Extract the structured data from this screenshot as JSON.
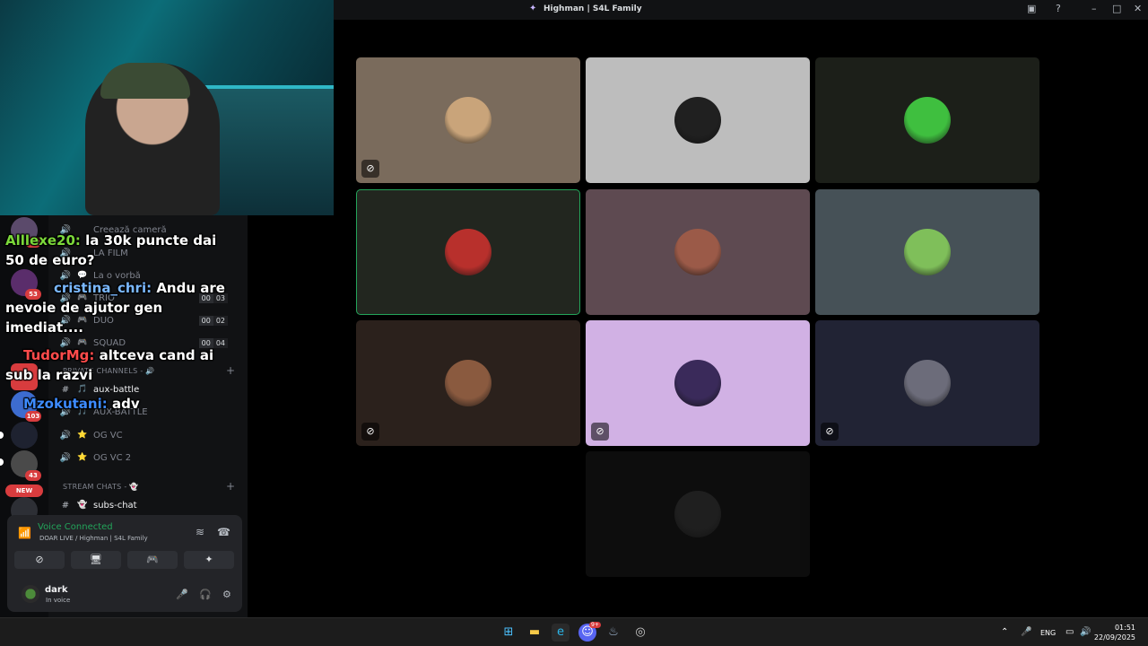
{
  "window": {
    "title": "Highman | S4L Family"
  },
  "server_rail": {
    "badges": [
      "143",
      "53",
      "103",
      "43",
      "10"
    ],
    "new_label": "NEW"
  },
  "channels": [
    {
      "name": "Creează cameră",
      "emoji": ""
    },
    {
      "name": "LA FILM",
      "emoji": ""
    },
    {
      "name": "La o vorbă",
      "emoji": "💬"
    },
    {
      "name": "TRIO",
      "emoji": "🎮",
      "count_a": "00",
      "count_b": "03"
    },
    {
      "name": "DUO",
      "emoji": "🎮",
      "count_a": "00",
      "count_b": "02"
    },
    {
      "name": "SQUAD",
      "emoji": "🎮",
      "count_a": "00",
      "count_b": "04"
    },
    {
      "name": "aux-battle",
      "emoji": "🎵"
    },
    {
      "name": "AUX-BATTLE",
      "emoji": "🎵"
    },
    {
      "name": "OG VC",
      "emoji": "⭐"
    },
    {
      "name": "OG VC 2",
      "emoji": "⭐"
    },
    {
      "name": "subs-chat",
      "emoji": "👻"
    }
  ],
  "categories": {
    "private": "PRIVATE CHANNELS - 🔊",
    "stream": "STREAM CHATS - 👻"
  },
  "chat_overlay": [
    {
      "user": "Alllexe20:",
      "text": " la 30k puncte dai 50 de euro?",
      "color": "#7bd83a"
    },
    {
      "user": "cristina_chri:",
      "text": " Andu are nevoie de ajutor gen imediat....",
      "color": "#7ab8ff"
    },
    {
      "user": "TudorMg:",
      "text": " altceva cand ai sub la razvi",
      "color": "#ff4b4b"
    },
    {
      "user": "Mzokutani:",
      "text": " adv",
      "color": "#3d8bff"
    }
  ],
  "voice": {
    "status": "Voice Connected",
    "channel": "DOAR LIVE / Highman | S4L Family"
  },
  "user": {
    "name": "dark",
    "status": "In voice"
  },
  "tiles": [
    {
      "bg": "#7a6b5c",
      "avatar": "#c9a47a",
      "muted": true,
      "mute_icon": "🎧"
    },
    {
      "bg": "#bdbdbd",
      "avatar": "#202020",
      "muted": false,
      "mute_icon": ""
    },
    {
      "bg": "#1c1f19",
      "avatar": "#3fbf3f",
      "muted": false,
      "mute_icon": ""
    },
    {
      "bg": "#22261f",
      "avatar": "#b8302c",
      "muted": false,
      "mute_icon": "",
      "speaking": true
    },
    {
      "bg": "#5e4a51",
      "avatar": "#9b5a48",
      "muted": false,
      "mute_icon": ""
    },
    {
      "bg": "#465157",
      "avatar": "#7fbf5a",
      "muted": false,
      "mute_icon": ""
    },
    {
      "bg": "#2b211c",
      "avatar": "#8a5a3f",
      "muted": true,
      "mute_icon": "🎧"
    },
    {
      "bg": "#d1b1e4",
      "avatar": "#3a2a5a",
      "muted": true,
      "mute_icon": "🎤"
    },
    {
      "bg": "#212334",
      "avatar": "#6c6c7a",
      "muted": true,
      "mute_icon": "🎤"
    },
    {
      "bg": "#0d0d0d",
      "avatar": "#1f1f1f",
      "muted": false,
      "mute_icon": ""
    }
  ],
  "taskbar": {
    "lang": "ENG",
    "time": "01:51",
    "date": "22/09/2025",
    "discord_badge": "9+"
  }
}
